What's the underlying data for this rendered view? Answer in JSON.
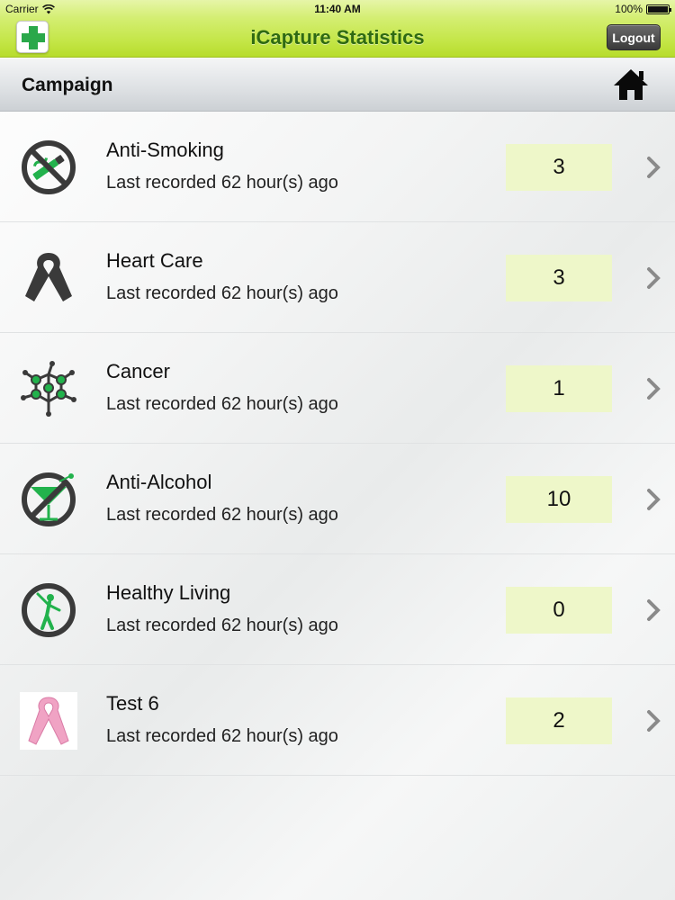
{
  "status_bar": {
    "carrier": "Carrier",
    "time": "11:40 AM",
    "battery": "100%"
  },
  "nav": {
    "title": "iCapture Statistics",
    "logout_label": "Logout"
  },
  "section": {
    "title": "Campaign"
  },
  "campaigns": [
    {
      "title": "Anti-Smoking",
      "subtitle": "Last recorded 62 hour(s) ago",
      "count": "3",
      "icon": "no-smoking-icon"
    },
    {
      "title": "Heart Care",
      "subtitle": "Last recorded 62 hour(s) ago",
      "count": "3",
      "icon": "awareness-ribbon-icon"
    },
    {
      "title": "Cancer",
      "subtitle": "Last recorded 62 hour(s) ago",
      "count": "1",
      "icon": "cell-network-icon"
    },
    {
      "title": "Anti-Alcohol",
      "subtitle": "Last recorded 62 hour(s) ago",
      "count": "10",
      "icon": "no-alcohol-icon"
    },
    {
      "title": "Healthy Living",
      "subtitle": "Last recorded 62 hour(s) ago",
      "count": "0",
      "icon": "stretching-person-icon"
    },
    {
      "title": "Test 6",
      "subtitle": "Last recorded 62 hour(s) ago",
      "count": "2",
      "icon": "pink-ribbon-icon"
    }
  ],
  "colors": {
    "nav_green": "#c4e647",
    "title_green": "#2f6a12",
    "count_bg": "#eef7c9",
    "icon_green": "#22b24c",
    "icon_dark": "#3a3a3a",
    "ribbon_pink": "#f0a3c4"
  }
}
